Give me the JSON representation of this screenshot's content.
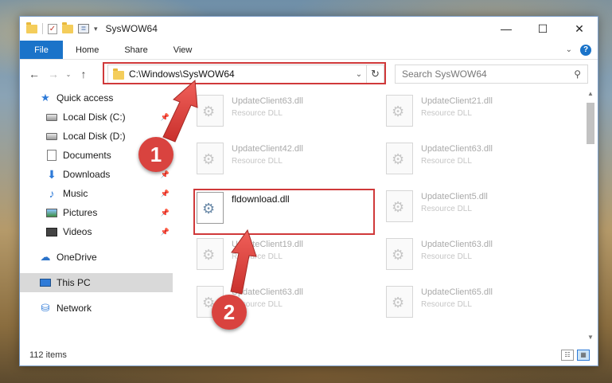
{
  "window": {
    "title": "SysWOW64",
    "qat_check": "✓",
    "qat_props": "≣",
    "qat_dropdown": "▾",
    "minimize": "—",
    "maximize": "☐",
    "close": "✕"
  },
  "ribbon": {
    "tabs": [
      "File",
      "Home",
      "Share",
      "View"
    ],
    "expand": "⌄",
    "help": "?"
  },
  "nav": {
    "back": "←",
    "forward": "→",
    "recent": "⌄",
    "up": "↑",
    "address": "C:\\Windows\\SysWOW64",
    "address_dropdown": "⌄",
    "refresh": "↻",
    "search_placeholder": "Search SysWOW64",
    "search_icon": "⚲"
  },
  "sidebar": {
    "items": [
      {
        "label": "Quick access",
        "icon": "star-icon"
      },
      {
        "label": "Local Disk (C:)",
        "icon": "drive-icon"
      },
      {
        "label": "Local Disk (D:)",
        "icon": "drive-icon"
      },
      {
        "label": "Documents",
        "icon": "documents-icon"
      },
      {
        "label": "Downloads",
        "icon": "download-icon"
      },
      {
        "label": "Music",
        "icon": "music-icon"
      },
      {
        "label": "Pictures",
        "icon": "pictures-icon"
      },
      {
        "label": "Videos",
        "icon": "videos-icon"
      },
      {
        "label": "OneDrive",
        "icon": "cloud-icon"
      },
      {
        "label": "This PC",
        "icon": "computer-icon"
      },
      {
        "label": "Network",
        "icon": "network-icon"
      }
    ],
    "glyphs": {
      "star": "★",
      "download": "⬇",
      "music": "♪",
      "cloud": "☁",
      "network": "⛁",
      "pin": "📌"
    }
  },
  "files": [
    {
      "name": "UpdateClient63.dll",
      "type": "Resource DLL"
    },
    {
      "name": "UpdateClient21.dll",
      "type": "Resource DLL"
    },
    {
      "name": "UpdateClient42.dll",
      "type": "Resource DLL"
    },
    {
      "name": "UpdateClient63.dll",
      "type": "Resource DLL"
    },
    {
      "name": "fldownload.dll",
      "type": ""
    },
    {
      "name": "UpdateClient5.dll",
      "type": "Resource DLL"
    },
    {
      "name": "UpdateClient19.dll",
      "type": "Resource DLL"
    },
    {
      "name": "UpdateClient63.dll",
      "type": "Resource DLL"
    },
    {
      "name": "UpdateClient63.dll",
      "type": "Resource DLL"
    },
    {
      "name": "UpdateClient65.dll",
      "type": "Resource DLL"
    }
  ],
  "status": {
    "count": "112 items",
    "details_view": "☷",
    "tiles_view": "▦"
  },
  "scrollbar": {
    "up": "▲",
    "down": "▼"
  },
  "callouts": [
    "1",
    "2"
  ],
  "colors": {
    "accent": "#1a73c9",
    "highlight": "#d0393a",
    "callout": "#d9433f"
  }
}
